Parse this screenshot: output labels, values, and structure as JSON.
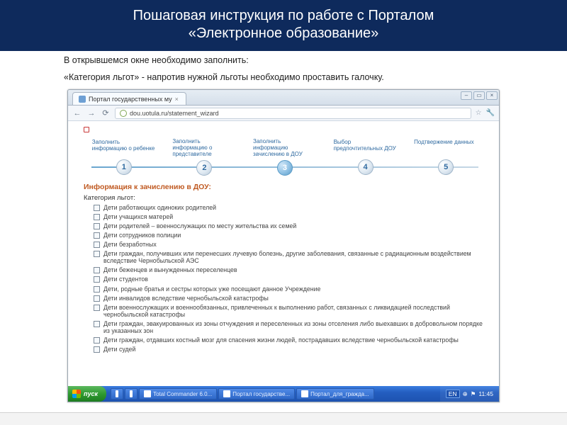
{
  "title_line1": "Пошаговая инструкция по работе с Порталом",
  "title_line2": "«Электронное образование»",
  "instruction_1": "В открывшемся окне необходимо заполнить:",
  "instruction_2": "«Категория льгот» - напротив нужной льготы необходимо проставить галочку.",
  "browser": {
    "tab_title": "Портал государственных му",
    "url": "dou.uotula.ru/statement_wizard",
    "nav_back": "←",
    "nav_fwd": "→",
    "nav_reload": "⟳",
    "star": "☆",
    "wrench": "🔧"
  },
  "wizard_steps": [
    {
      "num": "1",
      "label": "Заполнить информацию о ребенке"
    },
    {
      "num": "2",
      "label": "Заполнить информацию о представителе"
    },
    {
      "num": "3",
      "label": "Заполнить информацию зачислению в ДОУ"
    },
    {
      "num": "4",
      "label": "Выбор предпочтительных ДОУ"
    },
    {
      "num": "5",
      "label": "Подтвержение данных"
    }
  ],
  "section_heading": "Информация к зачислению в ДОУ:",
  "category_label": "Категория льгот:",
  "checkboxes": [
    "Дети работающих одиноких родителей",
    "Дети учащихся матерей",
    "Дети родителей – военнослужащих по месту жительства их семей",
    "Дети сотрудников полиции",
    "Дети безработных",
    "Дети граждан, получивших или перенесших лучевую болезнь, другие заболевания, связанные с радиационным воздействием вследствие Чернобыльской АЭС",
    "Дети беженцев и вынужденных переселенцев",
    "Дети студентов",
    "Дети, родные братья и сестры которых уже посещают данное Учреждение",
    "Дети инвалидов вследствие чернобыльской катастрофы",
    "Дети военнослужащих и военнообязанных, привлеченных к выполнению работ, связанных с ликвидацией последствий чернобыльской катастрофы",
    "Дети граждан, эвакуированных из зоны отчуждения и переселенных из зоны отселения либо выехавших в добровольном порядке из указанных зон",
    "Дети граждан, отдавших костный мозг для спасения жизни людей, пострадавших вследствие чернобыльской катастрофы",
    "Дети судей"
  ],
  "taskbar": {
    "start": "пуск",
    "items": [
      "",
      "",
      "Total Commander 6.0...",
      "Портал государстве...",
      "Портал_для_гражда..."
    ],
    "lang": "EN",
    "time": "11:45"
  }
}
